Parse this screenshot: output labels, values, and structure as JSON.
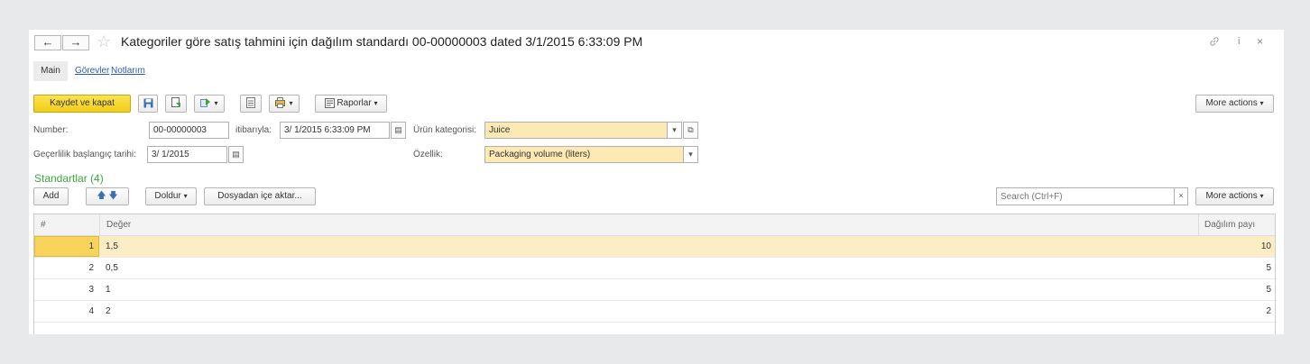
{
  "window": {
    "title": "Kategoriler göre satış tahmini için dağılım standardı 00-00000003 dated 3/1/2015 6:33:09 PM",
    "back_glyph": "←",
    "forward_glyph": "→",
    "favorite_glyph": "☆",
    "link_glyph": "🔗",
    "info_glyph": "i",
    "close_glyph": "×"
  },
  "tabs": [
    {
      "label": "Main"
    },
    {
      "label": "Görevler"
    },
    {
      "label": "Notlarım"
    }
  ],
  "toolbar": {
    "save_close_label": "Kaydet ve kapat",
    "reports_label": "Raporlar",
    "more_actions_label": "More actions"
  },
  "form": {
    "number_label": "Number:",
    "number_value": "00-00000003",
    "date_label": "itibarıyla:",
    "date_value": "3/ 1/2015  6:33:09 PM",
    "category_label": "Ürün kategorisi:",
    "category_value": "Juice",
    "start_label": "Geçerlilik başlangıç tarihi:",
    "start_value": "3/ 1/2015",
    "attribute_label": "Özellik:",
    "attribute_value": "Packaging volume (liters)"
  },
  "standards": {
    "title": "Standartlar (4)",
    "add_label": "Add",
    "fill_label": "Doldur",
    "import_label": "Dosyadan içe aktar...",
    "search_placeholder": "Search (Ctrl+F)",
    "more_actions_label": "More actions",
    "columns": [
      "#",
      "Değer",
      "Dağılım payı"
    ],
    "rows": [
      {
        "n": "1",
        "value": "1,5",
        "share": "10"
      },
      {
        "n": "2",
        "value": "0,5",
        "share": "5"
      },
      {
        "n": "3",
        "value": "1",
        "share": "5"
      },
      {
        "n": "4",
        "value": "2",
        "share": "2"
      }
    ]
  },
  "colors": {
    "accent_yellow": "#f2cd16",
    "section_green": "#3aa640",
    "link_blue": "#2a5bb8",
    "selected_row": "#fcedc4"
  }
}
